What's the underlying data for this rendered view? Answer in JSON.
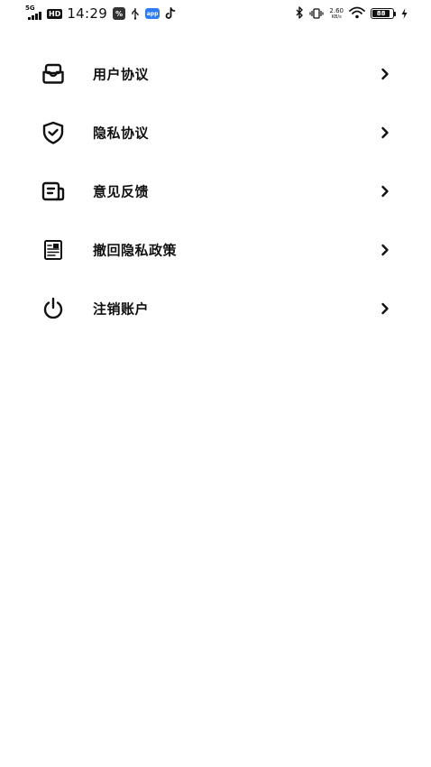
{
  "status_bar": {
    "network": "5G",
    "hd": "HD",
    "time": "14:29",
    "speed_value": "2.60",
    "speed_unit": "KB/s",
    "battery_percent": "88",
    "battery_level": 0.88
  },
  "menu": {
    "items": [
      {
        "label": "用户协议",
        "icon": "user-agreement-icon"
      },
      {
        "label": "隐私协议",
        "icon": "shield-check-icon"
      },
      {
        "label": "意见反馈",
        "icon": "feedback-icon"
      },
      {
        "label": "撤回隐私政策",
        "icon": "document-icon"
      },
      {
        "label": "注销账户",
        "icon": "power-icon"
      }
    ]
  },
  "colors": {
    "text": "#111111",
    "background": "#ffffff"
  }
}
